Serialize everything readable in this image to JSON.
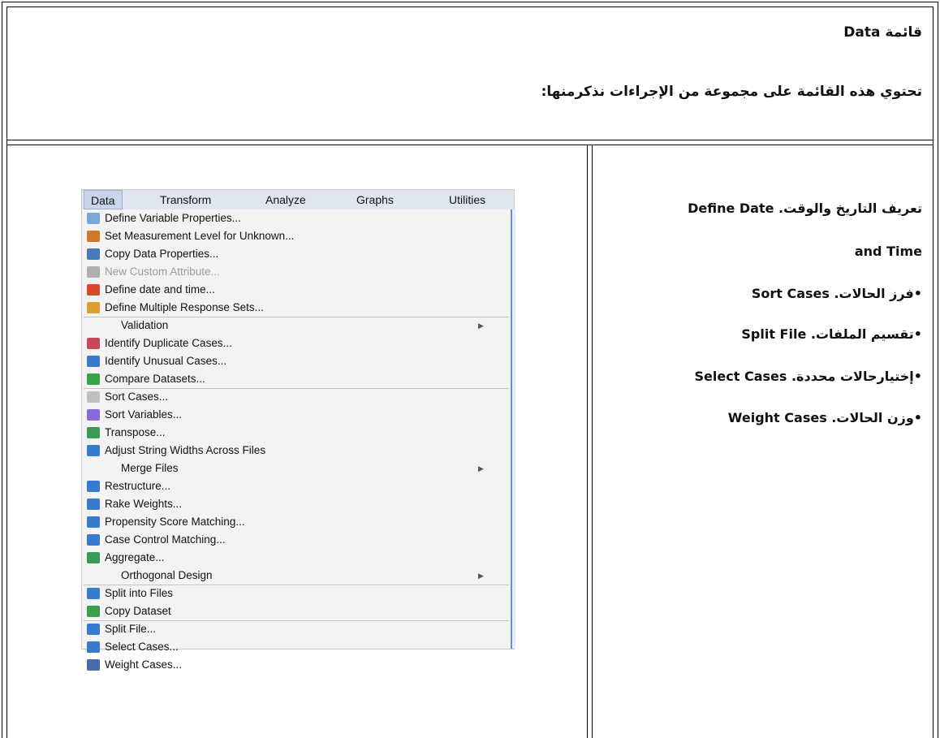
{
  "header": {
    "title": "قائمة Data",
    "subtitle": "تحتوي هذه القائمة على مجموعة من الإجراءات نذكرمنها:"
  },
  "right_column": {
    "line1": "تعريف التاريخ والوقت.  Define Date",
    "line2": "and Time",
    "items": [
      "•فرز الحالات.  Sort Cases",
      "•تقسيم الملفات.  Split File",
      "•إختيارحالات محددة.  Select Cases",
      "•وزن الحالات.  Weight Cases"
    ]
  },
  "menu": {
    "menubar": [
      "Data",
      "Transform",
      "Analyze",
      "Graphs",
      "Utilities"
    ],
    "items": [
      {
        "label": "Define Variable Properties...",
        "icon": "pencil-icon",
        "color": "#7aa7d8"
      },
      {
        "label": "Set Measurement Level for Unknown...",
        "icon": "measurement-icon",
        "color": "#d07a28"
      },
      {
        "label": "Copy Data Properties...",
        "icon": "copy-data-icon",
        "color": "#4a78b8"
      },
      {
        "label": "New Custom Attribute...",
        "icon": "custom-attribute-icon",
        "color": "#b0b0b0",
        "disabled": true
      },
      {
        "label": "Define date and time...",
        "icon": "calendar-icon",
        "color": "#d84a2a"
      },
      {
        "label": "Define Multiple Response Sets...",
        "icon": "response-sets-icon",
        "color": "#d8a02a"
      },
      {
        "label": "Validation",
        "submenu": true
      },
      {
        "label": "Identify Duplicate Cases...",
        "icon": "duplicate-icon",
        "color": "#c84a5a"
      },
      {
        "label": "Identify Unusual Cases...",
        "icon": "unusual-icon",
        "color": "#3a7acb"
      },
      {
        "label": "Compare Datasets...",
        "icon": "compare-icon",
        "color": "#3aa04a"
      },
      {
        "label": "Sort Cases...",
        "icon": "sort-cases-icon",
        "color": "#c0c0c0"
      },
      {
        "label": "Sort Variables...",
        "icon": "sort-variables-icon",
        "color": "#8a6ad8"
      },
      {
        "label": "Transpose...",
        "icon": "transpose-icon",
        "color": "#3a9a5a"
      },
      {
        "label": "Adjust String Widths Across Files",
        "icon": "plus-box-icon",
        "color": "#3a7acb"
      },
      {
        "label": "Merge Files",
        "submenu": true
      },
      {
        "label": "Restructure...",
        "icon": "restructure-icon",
        "color": "#3a7acb"
      },
      {
        "label": "Rake Weights...",
        "icon": "plus-box-icon",
        "color": "#3a7acb"
      },
      {
        "label": "Propensity Score Matching...",
        "icon": "plus-box-icon",
        "color": "#3a7acb"
      },
      {
        "label": "Case Control Matching...",
        "icon": "plus-box-icon",
        "color": "#3a7acb"
      },
      {
        "label": "Aggregate...",
        "icon": "aggregate-icon",
        "color": "#3a9a5a"
      },
      {
        "label": "Orthogonal Design",
        "submenu": true
      },
      {
        "label": "Split into Files",
        "icon": "plus-box-icon",
        "color": "#3a7acb"
      },
      {
        "label": "Copy Dataset",
        "icon": "copy-dataset-icon",
        "color": "#3aa04a"
      },
      {
        "label": "Split File...",
        "icon": "split-file-icon",
        "color": "#3a7acb"
      },
      {
        "label": "Select Cases...",
        "icon": "select-cases-icon",
        "color": "#3a7acb"
      },
      {
        "label": "Weight Cases...",
        "icon": "weight-icon",
        "color": "#4a6aa8"
      }
    ]
  }
}
